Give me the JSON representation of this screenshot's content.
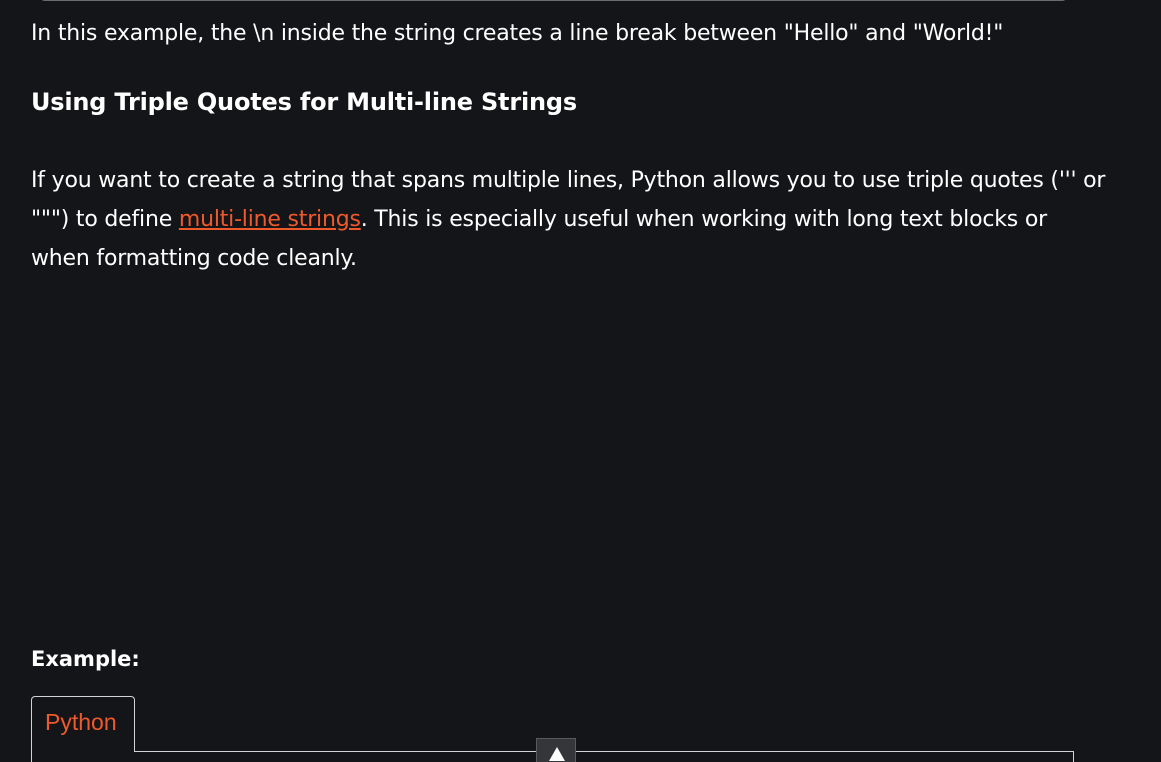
{
  "intro": {
    "text": "In this example, the \\n inside the string creates a line break between \"Hello\" and \"World!\""
  },
  "section": {
    "heading": "Using Triple Quotes for Multi-line Strings",
    "paragraph_before_link": "If you want to create a string that spans multiple lines, Python allows you to use triple quotes (''' or \"\"\") to define ",
    "link_text": "multi-line strings",
    "paragraph_after_link": ". This is especially useful when working with long text blocks or when formatting code cleanly."
  },
  "example": {
    "label": "Example:",
    "tabs": [
      {
        "label": "Python"
      }
    ]
  },
  "scroll_top": {
    "icon": "arrow-up-icon"
  },
  "colors": {
    "background": "#141519",
    "text": "#ffffff",
    "accent": "#f0592a"
  }
}
